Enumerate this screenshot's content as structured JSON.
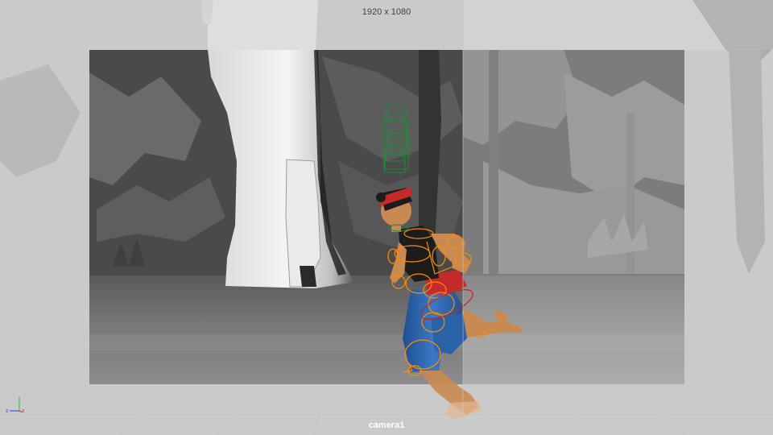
{
  "viewport": {
    "resolution_label": "1920 x 1080",
    "camera_label": "camera1"
  },
  "axis_gizmo": {
    "z_label": "z",
    "x_label": "x",
    "colors": {
      "y": "#2ecc40",
      "x": "#e0302a",
      "z": "#3a5bd9"
    }
  },
  "colors": {
    "viewport_background": "#bdbdbd",
    "gate_mask": "#d4d4d4",
    "rig_controls": "#ff8c00",
    "root_control": "#cc1f1f",
    "selected_cache": "#1f8a3a",
    "resolution_text": "#2d4f3a",
    "camera_text": "#ffffff"
  }
}
